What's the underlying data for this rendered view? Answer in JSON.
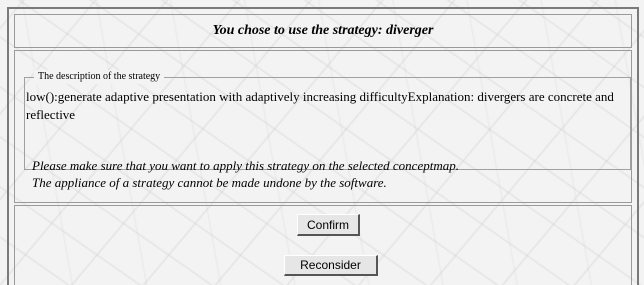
{
  "header": {
    "title": "You chose to use the strategy: diverger"
  },
  "description": {
    "legend": "The description of the strategy",
    "text": "low():generate adaptive presentation with adaptively increasing difficultyExplanation: divergers are concrete and reflective"
  },
  "warning": {
    "line1": "Please make sure that you want to apply this strategy on the selected conceptmap.",
    "line2": "The appliance of a strategy cannot be made undone by the software."
  },
  "buttons": {
    "confirm_label": "Confirm",
    "reconsider_label": "Reconsider"
  }
}
